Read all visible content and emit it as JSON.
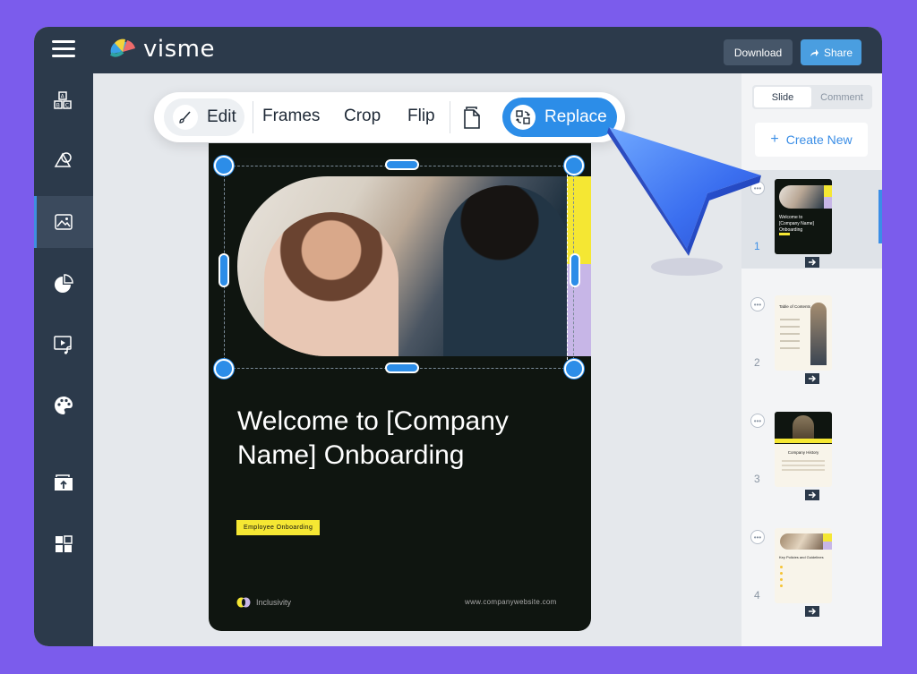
{
  "app": {
    "logo_text": "visme"
  },
  "topbar": {
    "download_label": "Download",
    "share_label": "Share"
  },
  "sidebar": {
    "items": [
      {
        "icon": "text-blocks-icon"
      },
      {
        "icon": "shapes-icon"
      },
      {
        "icon": "image-icon",
        "active": true
      },
      {
        "icon": "chart-icon"
      },
      {
        "icon": "media-icon"
      },
      {
        "icon": "palette-icon"
      },
      {
        "icon": "upload-icon"
      },
      {
        "icon": "apps-icon"
      }
    ]
  },
  "floating_toolbar": {
    "edit_label": "Edit",
    "frames_label": "Frames",
    "crop_label": "Crop",
    "flip_label": "Flip",
    "replace_label": "Replace"
  },
  "slide": {
    "title": "Welcome to [Company Name] Onboarding",
    "tag": "Employee Onboarding",
    "footer_brand": "Inclusivity",
    "footer_url": "www.companywebsite.com"
  },
  "right_panel": {
    "tab_slide": "Slide",
    "tab_comment": "Comment",
    "active_tab": "Slide",
    "create_new_label": "Create New",
    "slides": [
      {
        "number": "1",
        "title": "Welcome to [Company Name] Onboarding",
        "active": true
      },
      {
        "number": "2",
        "title": "Table of Contents"
      },
      {
        "number": "3",
        "title": "Company History"
      },
      {
        "number": "4",
        "title": "Key Policies and Guidelines"
      }
    ]
  },
  "colors": {
    "background": "#7b5cec",
    "topbar": "#2c3a4b",
    "accent_blue": "#2c8de8",
    "slide_bg": "#0f1510",
    "accent_yellow": "#f5e733",
    "accent_lilac": "#c7b6e7"
  }
}
